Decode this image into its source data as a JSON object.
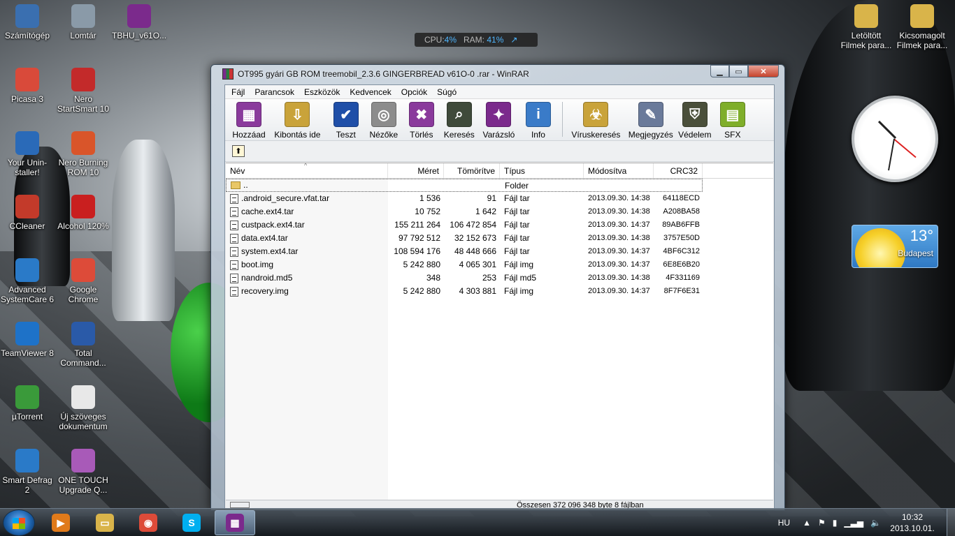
{
  "desktop": {
    "icons": [
      {
        "label": "Számítógép",
        "icon": "computer-icon"
      },
      {
        "label": "Lomtár",
        "icon": "recycle-bin-icon"
      },
      {
        "label": "TBHU_v61O...",
        "icon": "winrar-archive-icon"
      },
      {
        "label": "Picasa 3",
        "icon": "picasa-icon"
      },
      {
        "label": "Nero StartSmart 10",
        "icon": "nero-icon"
      },
      {
        "label": "Your Unin-staller!",
        "icon": "uninstaller-icon"
      },
      {
        "label": "Nero Burning ROM 10",
        "icon": "nero-burning-icon"
      },
      {
        "label": "CCleaner",
        "icon": "ccleaner-icon"
      },
      {
        "label": "Alcohol 120%",
        "icon": "alcohol-icon"
      },
      {
        "label": "Advanced SystemCare 6",
        "icon": "systemcare-icon"
      },
      {
        "label": "Google Chrome",
        "icon": "chrome-icon"
      },
      {
        "label": "TeamViewer 8",
        "icon": "teamviewer-icon"
      },
      {
        "label": "Total Command...",
        "icon": "floppy-icon"
      },
      {
        "label": "µTorrent",
        "icon": "utorrent-icon"
      },
      {
        "label": "Új szöveges dokumentum",
        "icon": "text-document-icon"
      },
      {
        "label": "Smart Defrag 2",
        "icon": "defrag-icon"
      },
      {
        "label": "ONE TOUCH Upgrade Q...",
        "icon": "onetouch-icon"
      },
      {
        "label": "Letöltött Filmek para...",
        "icon": "folder-shortcut-icon"
      },
      {
        "label": "Kicsomagolt Filmek para...",
        "icon": "folder-shortcut-icon"
      }
    ]
  },
  "gadgets": {
    "perf": {
      "cpu_label": "CPU:",
      "cpu_value": "4%",
      "ram_label": "RAM:",
      "ram_value": "41%"
    },
    "weather": {
      "temp": "13°",
      "city": "Budapest"
    }
  },
  "window": {
    "title": "OT995 gyári GB ROM treemobil_2.3.6 GINGERBREAD v61O-0 .rar - WinRAR",
    "menu": [
      "Fájl",
      "Parancsok",
      "Eszközök",
      "Kedvencek",
      "Opciók",
      "Súgó"
    ],
    "toolbar": [
      {
        "label": "Hozzáad",
        "icon": "add-archive-icon",
        "color": "#8a3a9c"
      },
      {
        "label": "Kibontás ide",
        "icon": "extract-folder-icon",
        "color": "#c9a33a"
      },
      {
        "label": "Teszt",
        "icon": "test-book-icon",
        "color": "#1f4fa8"
      },
      {
        "label": "Nézőke",
        "icon": "view-glasses-icon",
        "color": "#8c8c8c"
      },
      {
        "label": "Törlés",
        "icon": "delete-icon",
        "color": "#8a3a9c"
      },
      {
        "label": "Keresés",
        "icon": "binoculars-icon",
        "color": "#3f4a3a"
      },
      {
        "label": "Varázsló",
        "icon": "wizard-icon",
        "color": "#7b2a8c"
      },
      {
        "label": "Info",
        "icon": "info-icon",
        "color": "#3a7bc8"
      },
      {
        "label": "Víruskeresés",
        "icon": "virus-scan-icon",
        "color": "#c9a33a"
      },
      {
        "label": "Megjegyzés",
        "icon": "comment-icon",
        "color": "#6a7a9a"
      },
      {
        "label": "Védelem",
        "icon": "shield-icon",
        "color": "#4a4f3a"
      },
      {
        "label": "SFX",
        "icon": "sfx-icon",
        "color": "#7fae2a"
      }
    ],
    "columns": {
      "name": "Név",
      "size": "Méret",
      "packed": "Tömörítve",
      "type": "Típus",
      "modified": "Módosítva",
      "crc": "CRC32"
    },
    "parent_row": {
      "name": "..",
      "type": "Folder"
    },
    "files": [
      {
        "name": ".android_secure.vfat.tar",
        "size": "1 536",
        "packed": "91",
        "type": "Fájl tar",
        "modified": "2013.09.30. 14:38",
        "crc": "64118ECD"
      },
      {
        "name": "cache.ext4.tar",
        "size": "10 752",
        "packed": "1 642",
        "type": "Fájl tar",
        "modified": "2013.09.30. 14:38",
        "crc": "A208BA58"
      },
      {
        "name": "custpack.ext4.tar",
        "size": "155 211 264",
        "packed": "106 472 854",
        "type": "Fájl tar",
        "modified": "2013.09.30. 14:37",
        "crc": "89AB6FFB"
      },
      {
        "name": "data.ext4.tar",
        "size": "97 792 512",
        "packed": "32 152 673",
        "type": "Fájl tar",
        "modified": "2013.09.30. 14:38",
        "crc": "3757E50D"
      },
      {
        "name": "system.ext4.tar",
        "size": "108 594 176",
        "packed": "48 448 666",
        "type": "Fájl tar",
        "modified": "2013.09.30. 14:37",
        "crc": "4BF6C312"
      },
      {
        "name": "boot.img",
        "size": "5 242 880",
        "packed": "4 065 301",
        "type": "Fájl img",
        "modified": "2013.09.30. 14:37",
        "crc": "6E8E6B20"
      },
      {
        "name": "nandroid.md5",
        "size": "348",
        "packed": "253",
        "type": "Fájl md5",
        "modified": "2013.09.30. 14:38",
        "crc": "4F331169"
      },
      {
        "name": "recovery.img",
        "size": "5 242 880",
        "packed": "4 303 881",
        "type": "Fájl img",
        "modified": "2013.09.30. 14:37",
        "crc": "8F7F6E31"
      }
    ],
    "status": "Összesen 372 096 348 byte 8 fájlban"
  },
  "taskbar": {
    "apps": [
      {
        "name": "media-player",
        "icon": "media-player-icon",
        "color": "#e07a1a",
        "active": false
      },
      {
        "name": "explorer",
        "icon": "folder-icon",
        "color": "#d9b44a",
        "active": false
      },
      {
        "name": "chrome",
        "icon": "chrome-icon",
        "color": "#dd4b39",
        "active": false
      },
      {
        "name": "skype",
        "icon": "skype-icon",
        "color": "#00aff0",
        "active": false
      },
      {
        "name": "winrar",
        "icon": "winrar-icon",
        "color": "#7b2a8c",
        "active": true
      }
    ],
    "language": "HU",
    "time": "10:32",
    "date": "2013.10.01."
  }
}
